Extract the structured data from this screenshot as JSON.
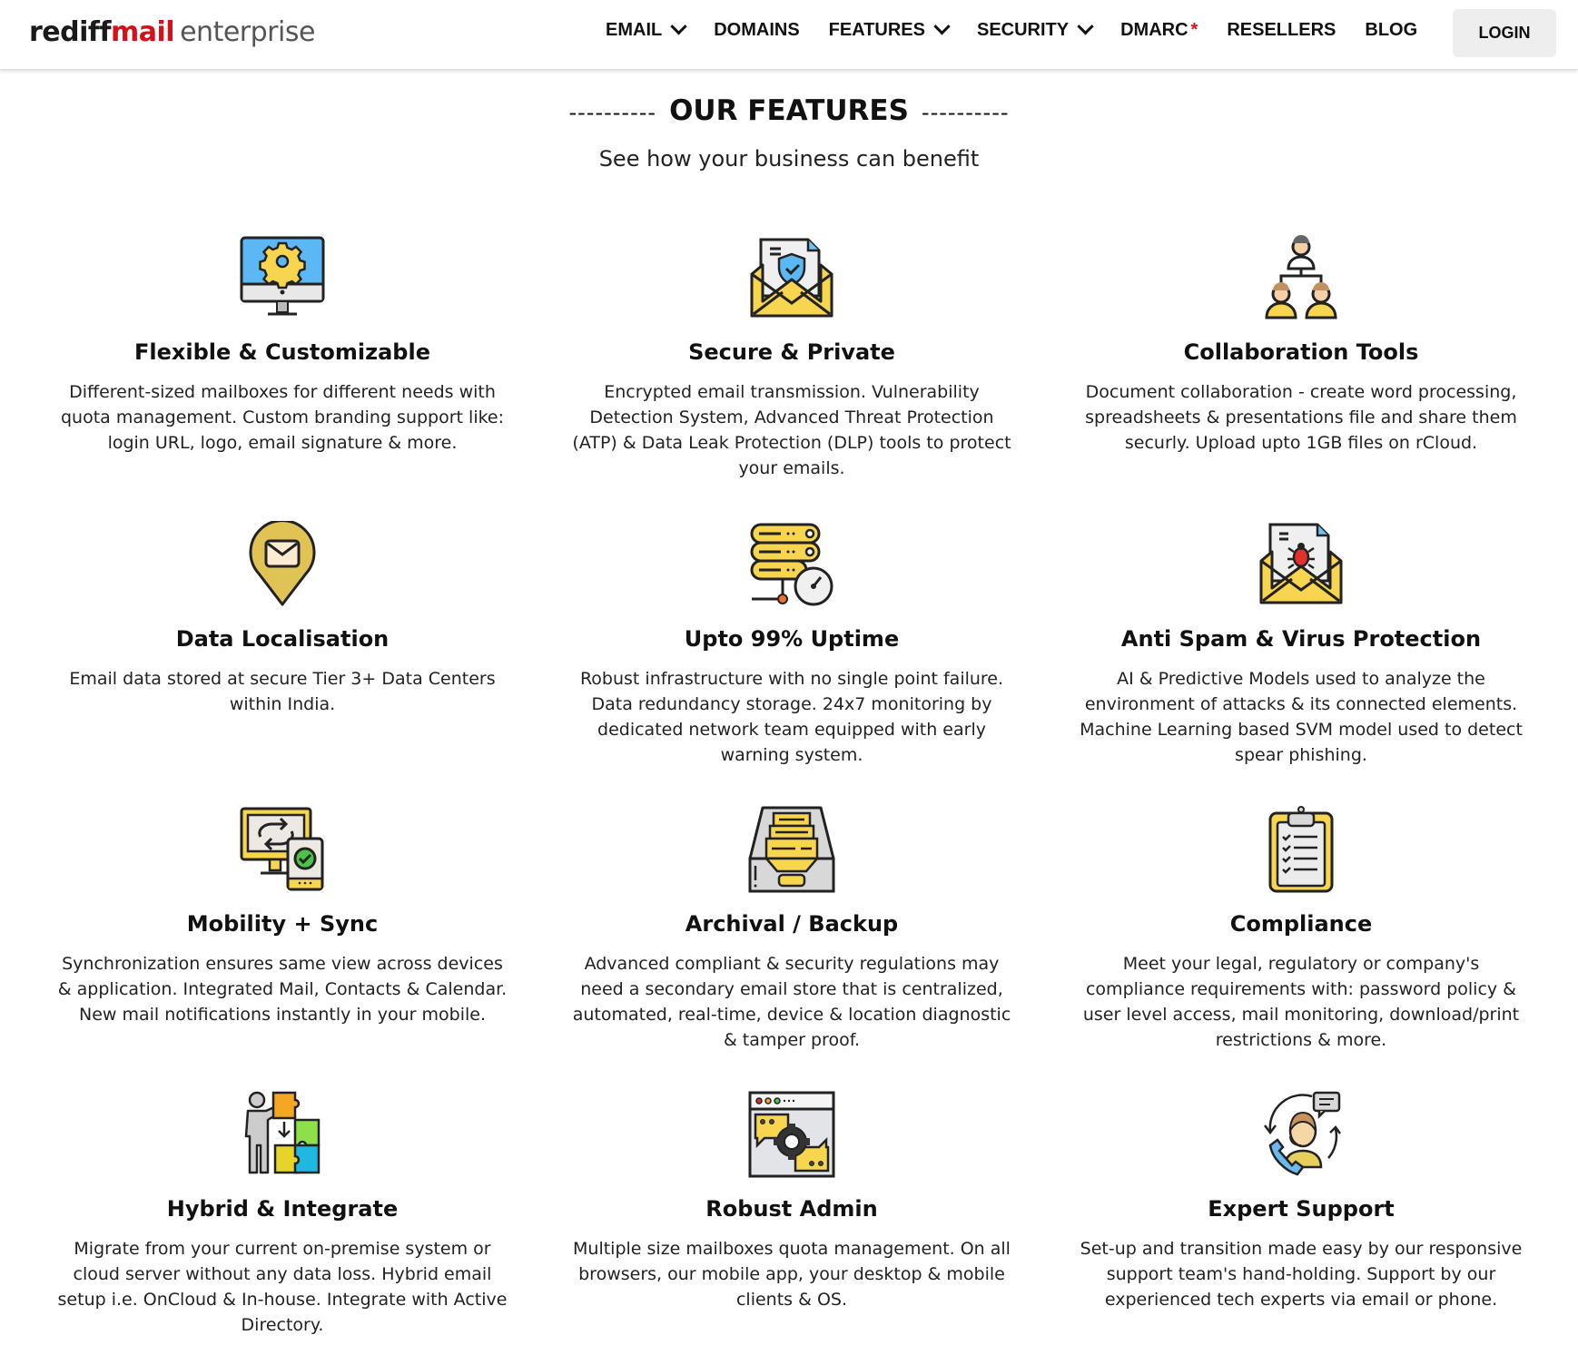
{
  "header": {
    "logo": {
      "part1": "rediff",
      "part2": "mail",
      "part3": "enterprise"
    },
    "nav": [
      {
        "label": "EMAIL",
        "dropdown": true
      },
      {
        "label": "DOMAINS",
        "dropdown": false
      },
      {
        "label": "FEATURES",
        "dropdown": true
      },
      {
        "label": "SECURITY",
        "dropdown": true
      },
      {
        "label": "DMARC",
        "dropdown": false,
        "badge": "*"
      },
      {
        "label": "RESELLERS",
        "dropdown": false
      },
      {
        "label": "BLOG",
        "dropdown": false
      }
    ],
    "login_label": "LOGIN"
  },
  "section": {
    "dashes": "----------",
    "title": "OUR FEATURES",
    "subtitle": "See how your business can benefit"
  },
  "features": [
    {
      "icon": "monitor-gear-icon",
      "title": "Flexible & Customizable",
      "desc": "Different-sized mailboxes for different needs with quota management. Custom branding support like: login URL, logo, email signature & more."
    },
    {
      "icon": "secure-envelope-icon",
      "title": "Secure & Private",
      "desc": "Encrypted email transmission. Vulnerability Detection System, Advanced Threat Protection (ATP) & Data Leak Protection (DLP) tools to protect your emails."
    },
    {
      "icon": "team-hierarchy-icon",
      "title": "Collaboration Tools",
      "desc": "Document collaboration - create word processing, spreadsheets & presentations file and share them securly. Upload upto 1GB files on rCloud."
    },
    {
      "icon": "location-pin-mail-icon",
      "title": "Data Localisation",
      "desc": "Email data stored at secure Tier 3+ Data Centers within India."
    },
    {
      "icon": "server-gauge-icon",
      "title": "Upto 99% Uptime",
      "desc": "Robust infrastructure with no single point failure. Data redundancy storage. 24x7 monitoring by dedicated network team equipped with early warning system."
    },
    {
      "icon": "envelope-bug-icon",
      "title": "Anti Spam & Virus Protection",
      "desc": "AI & Predictive Models used to analyze the environment of attacks & its connected elements. Machine Learning based SVM model used to detect spear phishing."
    },
    {
      "icon": "devices-sync-icon",
      "title": "Mobility + Sync",
      "desc": "Synchronization ensures same view across devices & application. Integrated Mail, Contacts & Calendar. New mail notifications instantly in your mobile."
    },
    {
      "icon": "archive-drawer-icon",
      "title": "Archival / Backup",
      "desc": "Advanced compliant & security regulations may need a secondary email store that is centralized, automated, real-time, device & location diagnostic & tamper proof."
    },
    {
      "icon": "clipboard-checklist-icon",
      "title": "Compliance",
      "desc": "Meet your legal, regulatory or company's compliance requirements with: password policy & user level access, mail monitoring, download/print restrictions & more."
    },
    {
      "icon": "puzzle-person-icon",
      "title": "Hybrid & Integrate",
      "desc": "Migrate from your current on-premise system or cloud server without any data loss. Hybrid email setup i.e. OnCloud & In-house. Integrate with Active Directory."
    },
    {
      "icon": "admin-window-gear-icon",
      "title": "Robust Admin",
      "desc": "Multiple size mailboxes quota management. On all browsers, our mobile app, your desktop & mobile clients & OS."
    },
    {
      "icon": "support-agent-icon",
      "title": "Expert Support",
      "desc": "Set-up and transition made easy by our responsive support team's hand-holding. Support by our experienced tech experts via email or phone."
    }
  ]
}
